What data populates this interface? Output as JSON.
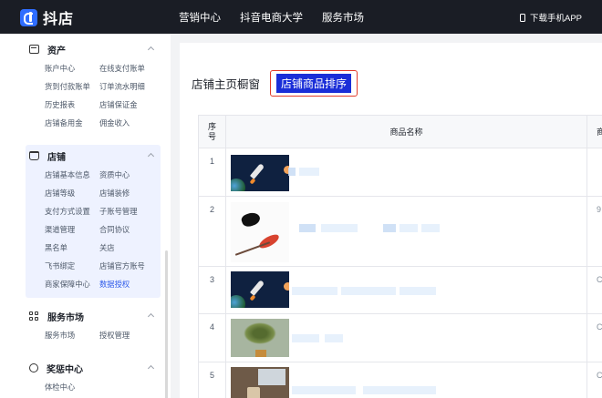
{
  "header": {
    "logo_text": "抖店",
    "nav": [
      "营销中心",
      "抖音电商大学",
      "服务市场"
    ],
    "download": "下载手机APP"
  },
  "sidebar": {
    "sections": [
      {
        "title": "资产",
        "icon": "wallet-icon",
        "items": [
          "账户中心",
          "在线支付账单",
          "货到付款账单",
          "订单流水明细",
          "历史报表",
          "店铺保证金",
          "店铺备用金",
          "佣金收入"
        ]
      },
      {
        "title": "店铺",
        "icon": "shop-icon",
        "items": [
          "店铺基本信息",
          "资质中心",
          "店铺等级",
          "店铺装修",
          "支付方式设置",
          "子账号管理",
          "渠道管理",
          "合同协议",
          "黑名单",
          "关店",
          "飞书绑定",
          "店铺官方账号",
          "商家保障中心",
          "数据授权"
        ],
        "selected": "数据授权"
      },
      {
        "title": "服务市场",
        "icon": "apps-grid-icon",
        "items": [
          "服务市场",
          "授权管理"
        ]
      },
      {
        "title": "奖惩中心",
        "icon": "medal-icon",
        "items": [
          "体检中心"
        ]
      }
    ]
  },
  "main": {
    "tabs": [
      "店铺主页橱窗",
      "店铺商品排序"
    ],
    "active_tab": "店铺商品排序",
    "table": {
      "headers": [
        "序号",
        "商品名称",
        "商"
      ],
      "rows": [
        {
          "no": "1",
          "extra": ""
        },
        {
          "no": "2",
          "extra": "9"
        },
        {
          "no": "3",
          "extra": "C"
        },
        {
          "no": "4",
          "extra": "C"
        },
        {
          "no": "5",
          "extra": "C"
        }
      ]
    }
  }
}
